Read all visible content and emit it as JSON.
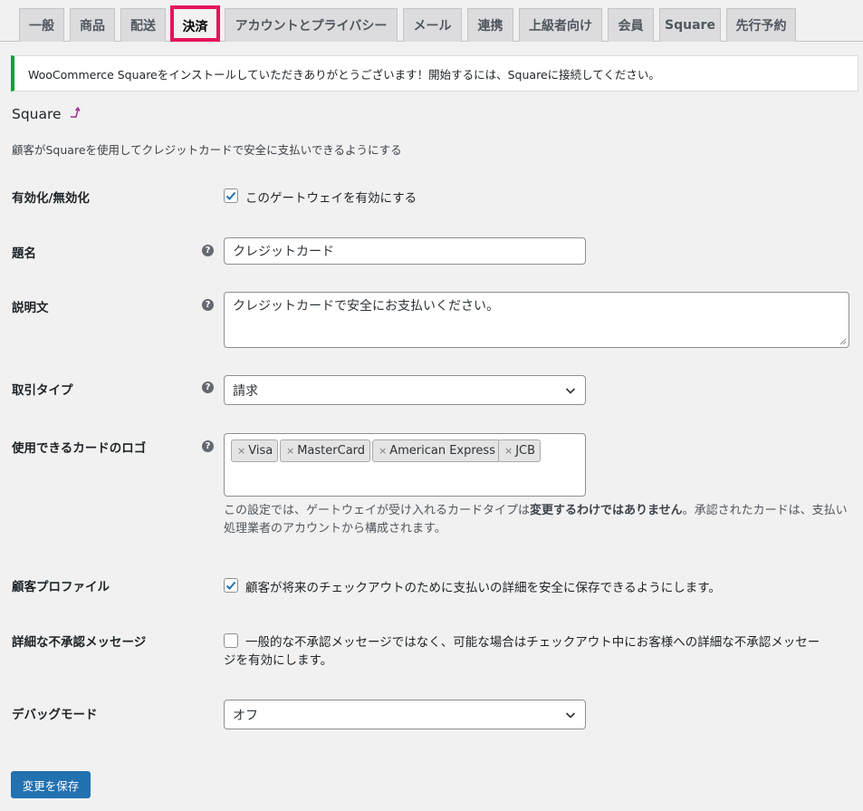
{
  "tabs": [
    {
      "label": "一般"
    },
    {
      "label": "商品"
    },
    {
      "label": "配送"
    },
    {
      "label": "決済",
      "active": true
    },
    {
      "label": "アカウントとプライバシー"
    },
    {
      "label": "メール"
    },
    {
      "label": "連携"
    },
    {
      "label": "上級者向け"
    },
    {
      "label": "会員"
    },
    {
      "label": "Square"
    },
    {
      "label": "先行予約"
    }
  ],
  "notice": {
    "text": "WooCommerce Squareをインストールしていただきありがとうございます！開始するには、Squareに接続してください。",
    "color": "#00a32a"
  },
  "section": {
    "title": "Square",
    "title_icon": "return-up-arrow-icon",
    "description": "顧客がSquareを使用してクレジットカードで安全に支払いできるようにする"
  },
  "fields": {
    "enable": {
      "label": "有効化/無効化",
      "checkbox_label": "このゲートウェイを有効にする",
      "checked": true
    },
    "title": {
      "label": "題名",
      "value": "クレジットカード"
    },
    "description": {
      "label": "説明文",
      "value": "クレジットカードで安全にお支払いください。"
    },
    "transaction_type": {
      "label": "取引タイプ",
      "value": "請求"
    },
    "card_logos": {
      "label": "使用できるカードのロゴ",
      "chips": [
        "Visa",
        "MasterCard",
        "American Express",
        "JCB"
      ],
      "help_prefix": "この設定では、ゲートウェイが受け入れるカードタイプは",
      "help_bold": "変更するわけではありません",
      "help_suffix": "。承認されたカードは、支払い処理業者のアカウントから構成されます。"
    },
    "customer_profiles": {
      "label": "顧客プロファイル",
      "checkbox_label": "顧客が将来のチェックアウトのために支払いの詳細を安全に保存できるようにします。",
      "checked": true
    },
    "detailed_decline": {
      "label": "詳細な不承認メッセージ",
      "checkbox_label_line1": "一般的な不承認メッセージではなく、可能な場合はチェックアウト中にお客様への詳細な不承認メッセー",
      "checkbox_label_line2": "ジを有効にします。",
      "checked": false
    },
    "debug_mode": {
      "label": "デバッグモード",
      "value": "オフ"
    }
  },
  "save_button": {
    "label": "変更を保存"
  },
  "colors": {
    "primary": "#2271b1",
    "highlight_border": "#e6135d",
    "success": "#00a32a"
  }
}
